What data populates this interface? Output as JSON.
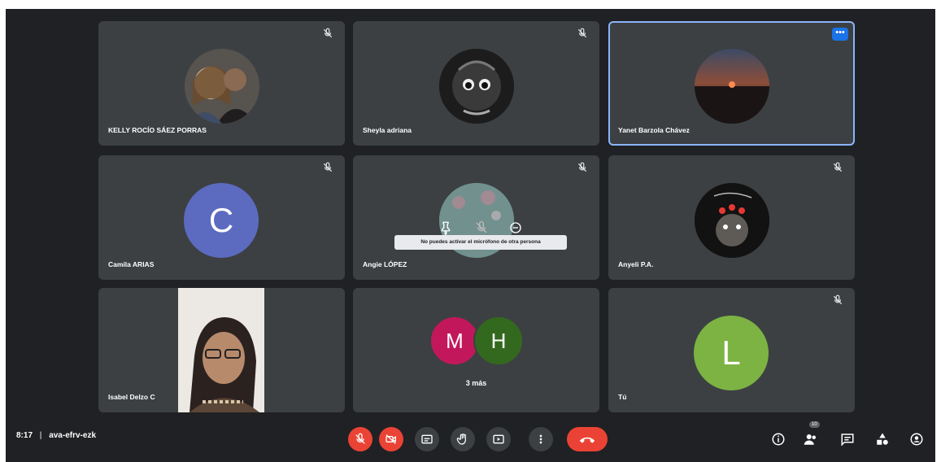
{
  "participants": [
    {
      "name": "KELLY ROCÍO SÁEZ PORRAS"
    },
    {
      "name": "Sheyla adriana"
    },
    {
      "name": "Yanet Barzola Chávez"
    },
    {
      "name": "Camila ARIAS",
      "initial": "C"
    },
    {
      "name": "Angie LÓPEZ"
    },
    {
      "name": "Anyeli P.A."
    },
    {
      "name": "Isabel Delzo C"
    },
    {
      "name": "Tú",
      "initial": "L"
    }
  ],
  "others": {
    "initial_1": "M",
    "initial_2": "H",
    "label": "3 más"
  },
  "tooltip": "No puedes activar el micrófono de otra persona",
  "meeting": {
    "time": "8:17",
    "separator": "|",
    "code": "ava-efrv-ezk"
  },
  "badges": {
    "people_count": "10",
    "tile_more": "•••"
  },
  "colors": {
    "camila": "#5c6bc0",
    "m": "#c2185b",
    "h": "#33691e",
    "l": "#7cb342",
    "hangup": "#ea4335",
    "active_border": "#8ab4f8"
  }
}
